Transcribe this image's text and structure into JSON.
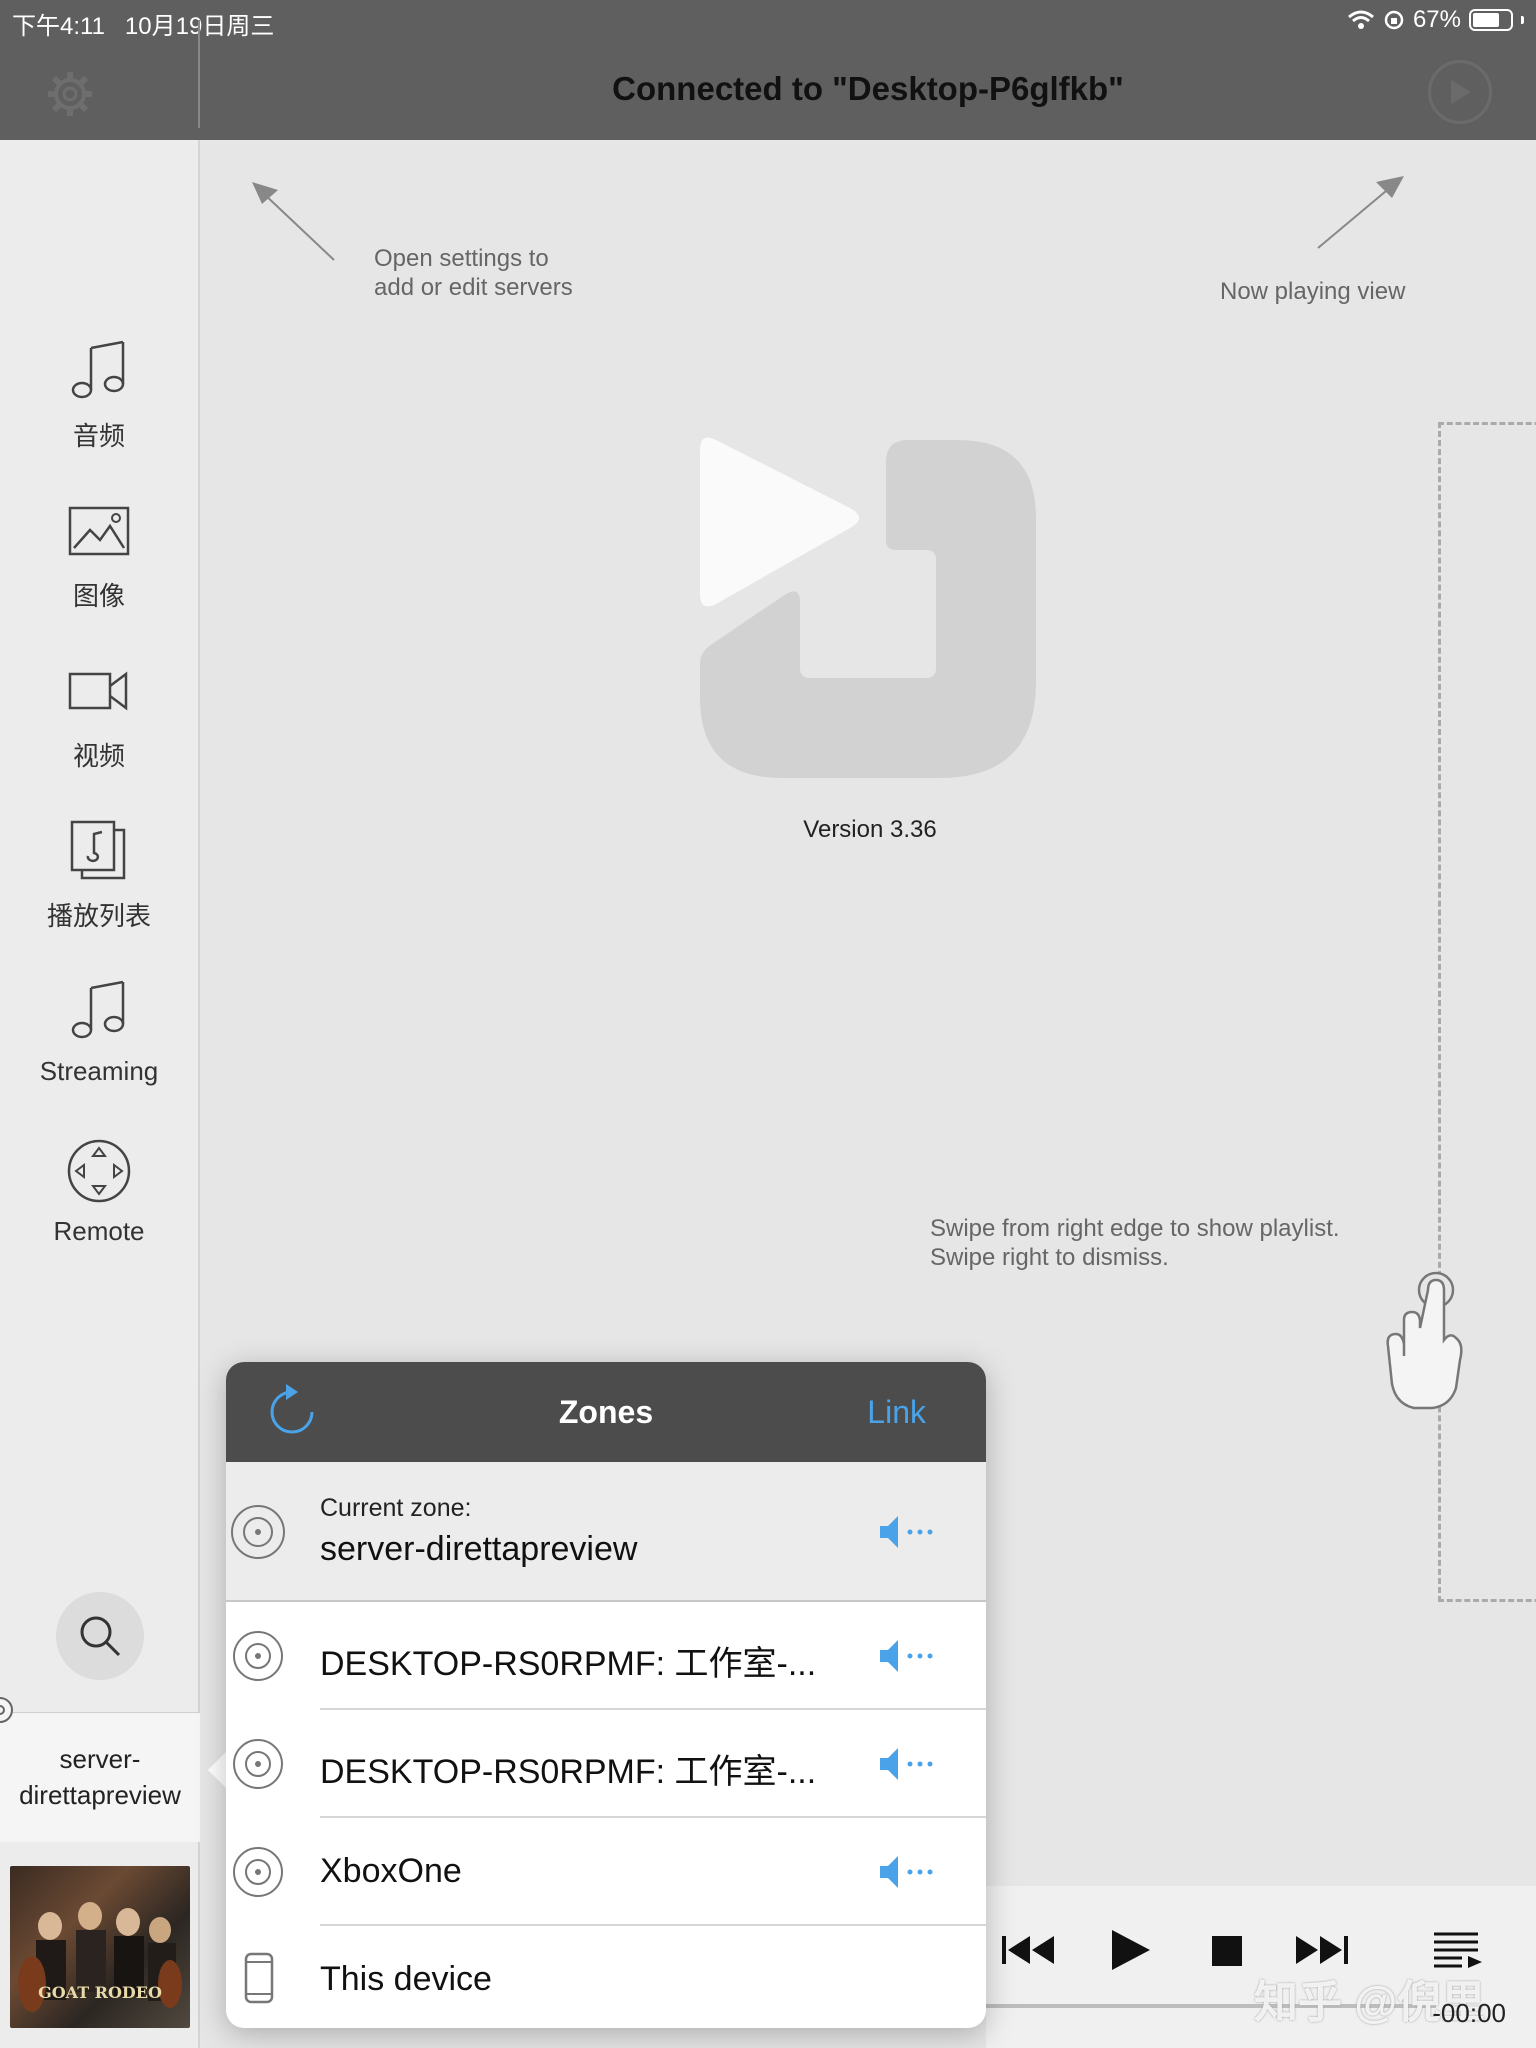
{
  "status_bar": {
    "time_date": "下午4:11   10月19日周三",
    "battery": "67%"
  },
  "header": {
    "title": "Connected to \"Desktop-P6glfkb\""
  },
  "hints": {
    "settings": "Open settings to\nadd or edit servers",
    "now_playing": "Now playing view",
    "swipe": "Swipe from right edge to show playlist.\nSwipe right to dismiss."
  },
  "version": "Version 3.36",
  "sidebar": {
    "items": [
      {
        "label": "音频",
        "icon": "music-note-icon"
      },
      {
        "label": "图像",
        "icon": "image-icon"
      },
      {
        "label": "视频",
        "icon": "video-camera-icon"
      },
      {
        "label": "播放列表",
        "icon": "playlist-icon"
      },
      {
        "label": "Streaming",
        "icon": "music-note-icon"
      },
      {
        "label": "Remote",
        "icon": "dpad-icon"
      }
    ],
    "current_zone": "server-\ndirettapreview"
  },
  "album": {
    "title": "GOAT RODEO"
  },
  "zones": {
    "title": "Zones",
    "link_label": "Link",
    "current_label": "Current zone:",
    "current_name": "server-direttapreview",
    "items": [
      {
        "name": "DESKTOP-RS0RPMF: 工作室-..."
      },
      {
        "name": "DESKTOP-RS0RPMF: 工作室-..."
      },
      {
        "name": "XboxOne"
      },
      {
        "name": "This device"
      }
    ]
  },
  "player": {
    "remaining": "-00:00",
    "watermark": "知乎 @倪里"
  },
  "colors": {
    "accent": "#4aa3e8",
    "header_bg": "#5f5f5f",
    "popover_header": "#4c4c4c"
  }
}
